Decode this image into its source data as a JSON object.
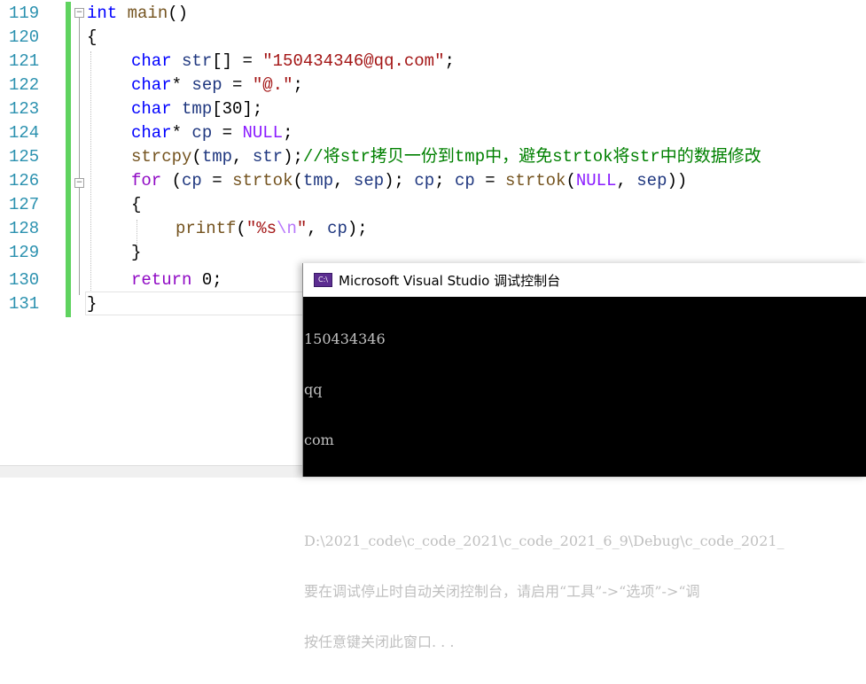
{
  "editor": {
    "lines": [
      {
        "num": "119"
      },
      {
        "num": "120"
      },
      {
        "num": "121"
      },
      {
        "num": "122"
      },
      {
        "num": "123"
      },
      {
        "num": "124"
      },
      {
        "num": "125"
      },
      {
        "num": "126"
      },
      {
        "num": "127"
      },
      {
        "num": "128"
      },
      {
        "num": "129"
      },
      {
        "num": "130"
      },
      {
        "num": "131"
      }
    ],
    "tokens": {
      "l119": {
        "kw": "int",
        "fn": "main",
        "rest": "()"
      },
      "l120": {
        "brace": "{"
      },
      "l121": {
        "kw": "char",
        "var": "str",
        "op": "[] = ",
        "str": "\"150434346@qq.com\"",
        "end": ";"
      },
      "l122": {
        "kw": "char",
        "op1": "* ",
        "var": "sep",
        "op2": " = ",
        "str": "\"@.\"",
        "end": ";"
      },
      "l123": {
        "kw": "char",
        "var": "tmp",
        "op": "[30];"
      },
      "l124": {
        "kw": "char",
        "op1": "* ",
        "var": "cp",
        "op2": " = ",
        "mac": "NULL",
        "end": ";"
      },
      "l125": {
        "fn": "strcpy",
        "p1": "(",
        "v1": "tmp",
        "c": ", ",
        "v2": "str",
        "p2": ");",
        "cmt": "//将str拷贝一份到tmp中，避免strtok将str中的数据修改"
      },
      "l126": {
        "kw": "for",
        "p0": " (",
        "v1": "cp",
        "eq": " = ",
        "fn1": "strtok",
        "p1": "(",
        "v2": "tmp",
        "c1": ", ",
        "v3": "sep",
        "p2": "); ",
        "v4": "cp",
        "s1": "; ",
        "v5": "cp",
        "eq2": " = ",
        "fn2": "strtok",
        "p3": "(",
        "mac": "NULL",
        "c2": ", ",
        "v6": "sep",
        "p4": "))"
      },
      "l127": {
        "brace": "{"
      },
      "l128": {
        "fn": "printf",
        "p1": "(",
        "str1": "\"%s",
        "esc": "\\n",
        "str2": "\"",
        "c": ", ",
        "v": "cp",
        "p2": ");"
      },
      "l129": {
        "brace": "}"
      },
      "l130": {
        "kw": "return",
        "rest": " 0;"
      },
      "l131": {
        "brace": "}"
      }
    }
  },
  "console": {
    "title": "Microsoft Visual Studio 调试控制台",
    "icon": "console-app-icon",
    "icon_label": "C:\\",
    "output": [
      "150434346",
      "qq",
      "com",
      "",
      "D:\\2021_code\\c_code_2021\\c_code_2021_6_9\\Debug\\c_code_2021_",
      "要在调试停止时自动关闭控制台，请启用“工具”->“选项”->“调",
      "按任意键关闭此窗口. . ."
    ]
  },
  "colors": {
    "line_number": "#2b91af",
    "keyword": "#0000ff",
    "control_keyword": "#8f08c4",
    "function": "#74531f",
    "string": "#a31515",
    "comment": "#008000",
    "change_bar": "#5fd35f",
    "console_bg": "#000000",
    "console_text": "#c0c0c0"
  }
}
